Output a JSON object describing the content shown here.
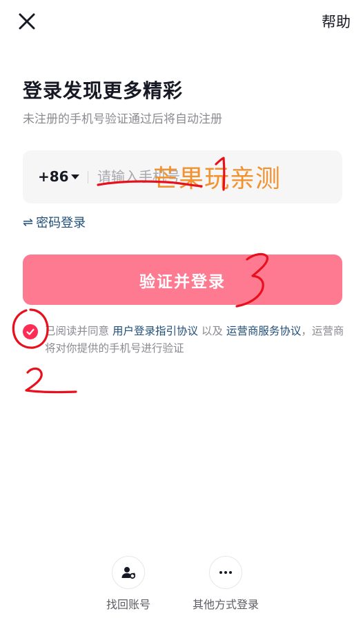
{
  "header": {
    "help_label": "帮助"
  },
  "main": {
    "title": "登录发现更多精彩",
    "subtitle": "未注册的手机号验证通过后将自动注册",
    "phone": {
      "country_code": "+86",
      "placeholder": "请输入手机号",
      "value": ""
    },
    "watermark": "芒果玩亲测",
    "password_login_label": "密码登录",
    "submit_label": "验证并登录",
    "agreement": {
      "checked": true,
      "prefix": "已阅读并同意 ",
      "link1": "用户登录指引协议",
      "middle": " 以及 ",
      "link2": "运营商服务协议",
      "suffix": "，运营商将对你提供的手机号进行验证"
    }
  },
  "bottom": {
    "recover_label": "找回账号",
    "other_label": "其他方式登录"
  },
  "annotations": {
    "marks": [
      "1",
      "2",
      "3"
    ],
    "color": "#e8101c"
  },
  "colors": {
    "accent": "#fe2c55",
    "button": "#fe7a91",
    "link": "#1f4e79",
    "watermark": "#f2922e"
  }
}
